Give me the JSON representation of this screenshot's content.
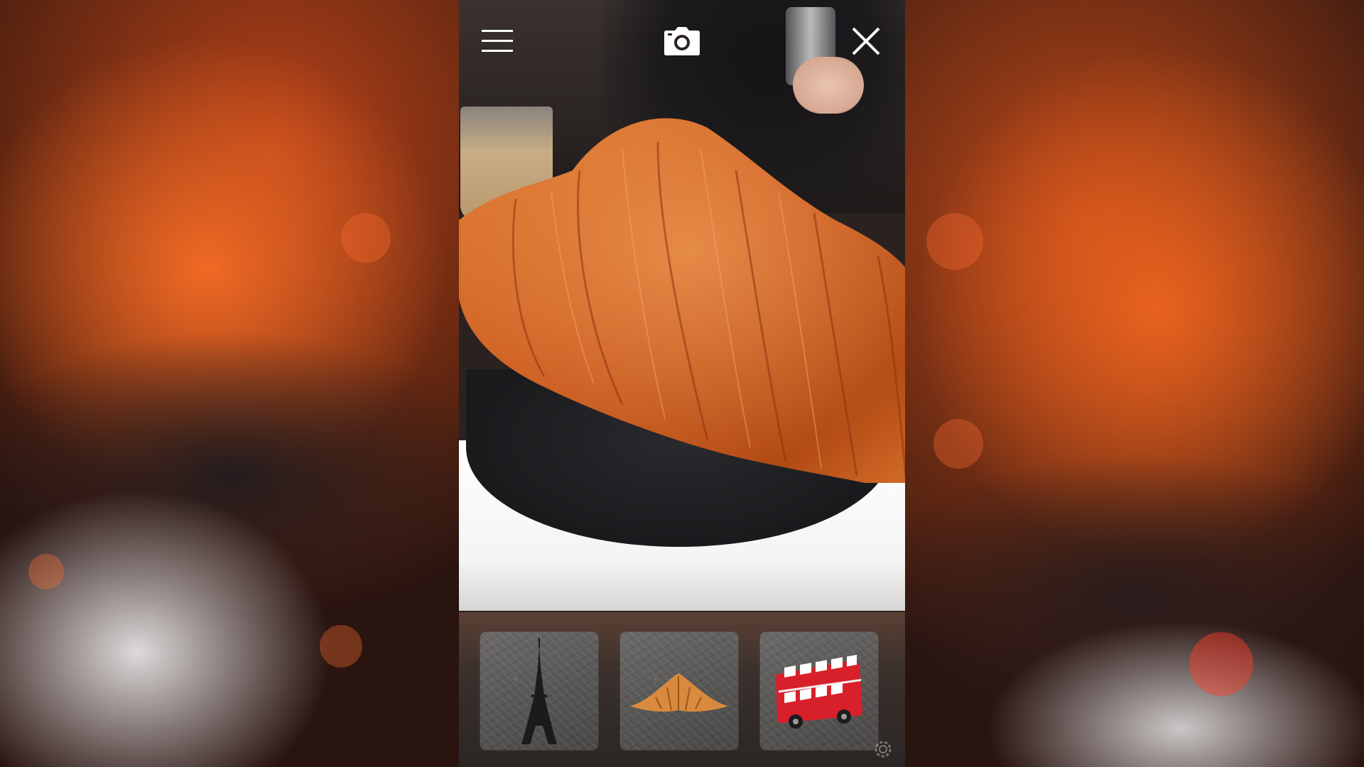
{
  "app": {
    "mode": "ar-camera-view"
  },
  "top_bar": {
    "icons": [
      "menu-icon",
      "camera-icon",
      "close-icon"
    ]
  },
  "scene": {
    "object": "croissant"
  },
  "thumbnails": [
    {
      "id": "eiffel-tower",
      "icon": "eiffel-tower-icon"
    },
    {
      "id": "croissant",
      "icon": "croissant-icon"
    },
    {
      "id": "london-bus",
      "icon": "double-decker-bus-icon"
    }
  ],
  "colors": {
    "accent": "#e8621e",
    "bus_red": "#d8202a",
    "icon_white": "#ffffff"
  }
}
